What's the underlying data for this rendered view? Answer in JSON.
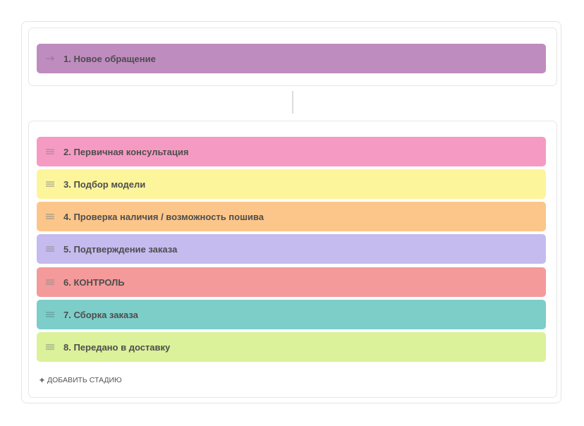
{
  "first_stage": {
    "label": "1. Новое обращение",
    "color": "#bf8cbf",
    "icon": "arrow-right-icon"
  },
  "stages": [
    {
      "label": "2. Первичная консультация",
      "color": "#f59bc3",
      "icon": "drag-handle-icon"
    },
    {
      "label": "3. Подбор модели",
      "color": "#fdf59b",
      "icon": "drag-handle-icon"
    },
    {
      "label": "4. Проверка наличия / возможность пошива",
      "color": "#fcc68a",
      "icon": "drag-handle-icon"
    },
    {
      "label": "5. Подтверждение заказа",
      "color": "#c5bbef",
      "icon": "drag-handle-icon"
    },
    {
      "label": "6. КОНТРОЛЬ",
      "color": "#f49a9b",
      "icon": "drag-handle-icon"
    },
    {
      "label": "7. Сборка заказа",
      "color": "#7dcdc9",
      "icon": "drag-handle-icon"
    },
    {
      "label": "8. Передано в доставку",
      "color": "#dbf19a",
      "icon": "drag-handle-icon"
    }
  ],
  "add_stage": {
    "plus": "+",
    "label": "ДОБАВИТЬ СТАДИЮ"
  }
}
